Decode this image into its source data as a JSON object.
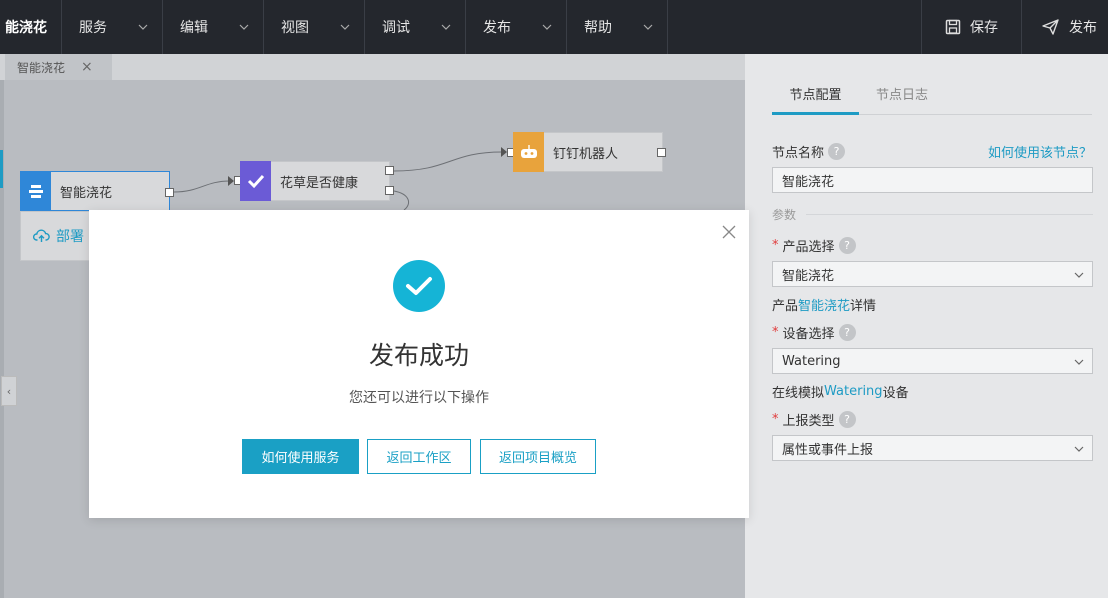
{
  "topbar": {
    "app_title": "能浇花",
    "menus": [
      "服务",
      "编辑",
      "视图",
      "调试",
      "发布",
      "帮助"
    ],
    "save_label": "保存",
    "publish_label": "发布"
  },
  "canvas": {
    "tab_label": "智能浇花",
    "tab_close": "×",
    "nodes": {
      "product": "智能浇花",
      "check": "花草是否健康",
      "robot": "钉钉机器人"
    },
    "deploy_label": "部署",
    "collapse_glyph": "‹"
  },
  "panel": {
    "tabs": [
      "节点配置",
      "节点日志"
    ],
    "node_name_label": "节点名称",
    "help_glyph": "?",
    "how_to_link": "如何使用该节点？",
    "node_name_value": "智能浇花",
    "params_label": "参数",
    "product_label": "产品选择",
    "product_value": "智能浇花",
    "product_detail_prefix": "产品",
    "product_detail_link": "智能浇花",
    "product_detail_suffix": "详情",
    "device_label": "设备选择",
    "device_value": "Watering",
    "device_sim_prefix": "在线模拟",
    "device_sim_link": "Watering",
    "device_sim_suffix": "设备",
    "report_label": "上报类型",
    "report_value": "属性或事件上报",
    "required_mark": "*"
  },
  "modal": {
    "title": "发布成功",
    "subtitle": "您还可以进行以下操作",
    "buttons": [
      "如何使用服务",
      "返回工作区",
      "返回项目概览"
    ]
  },
  "colors": {
    "accent": "#1aa0c5",
    "topbar_bg": "#24272d",
    "success": "#15b4d6",
    "node_robot": "#e8a33c",
    "node_check": "#6b5bd6",
    "node_product": "#2f87d8"
  }
}
